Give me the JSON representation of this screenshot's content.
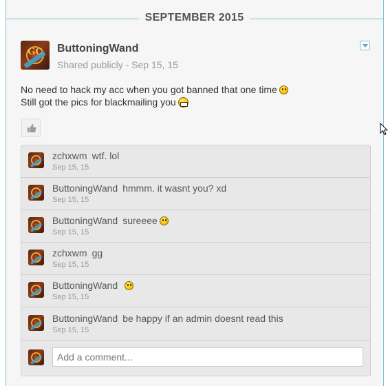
{
  "timeline": {
    "month_label": "SEPTEMBER 2015"
  },
  "post": {
    "author": "ButtoningWand",
    "meta": "Shared publicly - Sep 15, 15",
    "avatar_glyph": "GC",
    "lines": [
      {
        "text": "No need to hack my acc when you got banned that one time",
        "emoji": "smiley"
      },
      {
        "text": "Still got the pics for blackmailing you",
        "emoji": "grin"
      }
    ],
    "like_icon": "thumbs-up-icon",
    "menu_icon": "chevron-down-icon"
  },
  "comments": [
    {
      "author": "zchxwm",
      "text": "wtf. lol",
      "date": "Sep 15, 15",
      "emoji": ""
    },
    {
      "author": "ButtoningWand",
      "text": "hmmm. it wasnt you? xd",
      "date": "Sep 15, 15",
      "emoji": ""
    },
    {
      "author": "ButtoningWand",
      "text": "sureeee",
      "date": "Sep 15, 15",
      "emoji": "smiley"
    },
    {
      "author": "zchxwm",
      "text": "gg",
      "date": "Sep 15, 15",
      "emoji": ""
    },
    {
      "author": "ButtoningWand",
      "text": "",
      "date": "Sep 15, 15",
      "emoji": "smiley"
    },
    {
      "author": "ButtoningWand",
      "text": "be happy if an admin doesnt read this",
      "date": "Sep 15, 15",
      "emoji": ""
    }
  ],
  "compose": {
    "placeholder": "Add a comment..."
  },
  "colors": {
    "accent": "#7fc1d3",
    "panel": "#f6f6f6",
    "comment_bg": "#e8e8e8"
  }
}
